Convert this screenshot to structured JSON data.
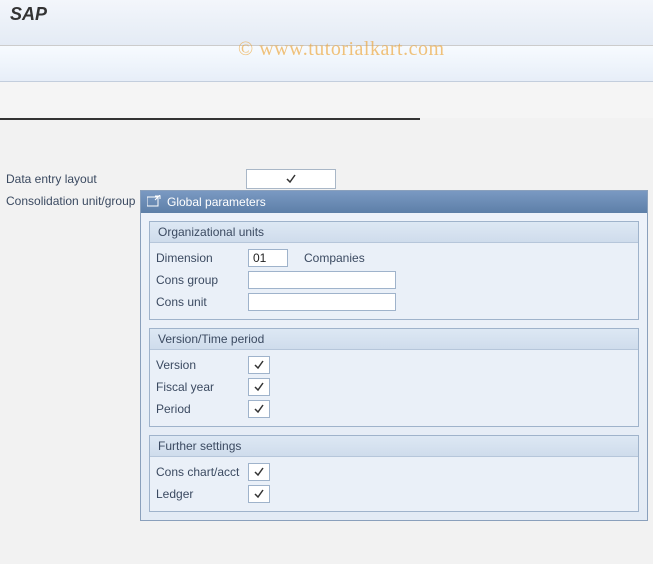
{
  "title": "SAP",
  "watermark": "© www.tutorialkart.com",
  "bg": {
    "data_entry_layout_label": "Data entry layout",
    "consolidation_label": "Consolidation unit/group"
  },
  "dialog": {
    "title": "Global parameters",
    "org": {
      "title": "Organizational units",
      "dimension_label": "Dimension",
      "dimension_value": "01",
      "dimension_desc": "Companies",
      "cons_group_label": "Cons group",
      "cons_group_value": "",
      "cons_unit_label": "Cons unit",
      "cons_unit_value": ""
    },
    "vt": {
      "title": "Version/Time period",
      "version_label": "Version",
      "fiscal_year_label": "Fiscal year",
      "period_label": "Period"
    },
    "further": {
      "title": "Further settings",
      "cons_chart_label": "Cons chart/acct",
      "ledger_label": "Ledger"
    }
  }
}
